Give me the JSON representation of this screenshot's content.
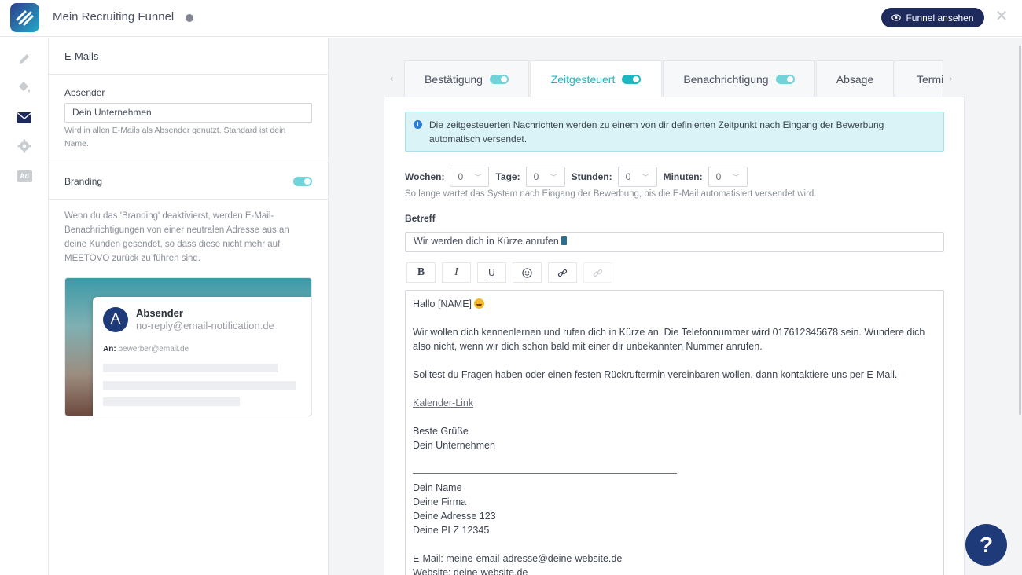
{
  "app": {
    "funnel_title": "Mein Recruiting Funnel",
    "view_button": "Funnel ansehen"
  },
  "rail": {
    "icons": [
      "pencil-icon",
      "paint-bucket-icon",
      "envelope-icon",
      "gear-icon",
      "ad-icon"
    ],
    "active": "envelope-icon",
    "ad_label": "Ad"
  },
  "panel": {
    "header": "E-Mails",
    "sender": {
      "label": "Absender",
      "value": "Dein Unternehmen",
      "hint": "Wird in allen E-Mails als Absender genutzt. Standard ist dein Name."
    },
    "branding": {
      "label": "Branding",
      "enabled": true,
      "description": "Wenn du das 'Branding' deaktivierst, werden E-Mail-Benachrichtigungen von einer neutralen Adresse aus an deine Kunden gesendet, so dass diese nicht mehr auf MEETOVO zurück zu führen sind."
    },
    "preview": {
      "avatar_letter": "A",
      "sender_name": "Absender",
      "sender_email": "no-reply@email-notification.de",
      "to_label": "An:",
      "to_email": "bewerber@email.de"
    }
  },
  "tabs": [
    {
      "label": "Bestätigung",
      "toggle": true,
      "active": false
    },
    {
      "label": "Zeitgesteuert",
      "toggle": true,
      "active": true
    },
    {
      "label": "Benachrichtigung",
      "toggle": true,
      "active": false
    },
    {
      "label": "Absage",
      "toggle": false,
      "active": false
    },
    {
      "label": "Termi",
      "toggle": false,
      "active": false
    }
  ],
  "content": {
    "info": "Die zeitgesteuerten Nachrichten werden zu einem von dir definierten Zeitpunkt nach Eingang der Bewerbung automatisch versendet.",
    "delay": {
      "weeks_label": "Wochen:",
      "weeks": "0",
      "days_label": "Tage:",
      "days": "0",
      "hours_label": "Stunden:",
      "hours": "0",
      "minutes_label": "Minuten:",
      "minutes": "0",
      "hint": "So lange wartet das System nach Eingang der Bewerbung, bis die E-Mail automatisiert versendet wird."
    },
    "subject_label": "Betreff",
    "subject_value": "Wir werden dich in Kürze anrufen",
    "toolbar": {
      "bold": "B",
      "italic": "I",
      "underline": "U"
    },
    "body": {
      "greeting": "Hallo [NAME]",
      "line1": "Wir wollen dich kennenlernen und rufen dich in Kürze an. Die Telefonnummer wird 017612345678 sein. Wundere dich also nicht, wenn wir dich schon bald mit einer dir unbekannten Nummer anrufen.",
      "line2": "Solltest du Fragen haben oder einen festen Rückruftermin vereinbaren wollen, dann kontaktiere uns per E-Mail.",
      "calendar_link": "Kalender-Link",
      "regards": "Beste Grüße",
      "company": "Dein Unternehmen",
      "sig_name": "Dein Name",
      "sig_firm": "Deine Firma",
      "sig_address": "Deine Adresse 123",
      "sig_zip": "Deine PLZ 12345",
      "sig_email": "E-Mail: meine-email-adresse@deine-website.de",
      "sig_web": "Website: deine-website.de"
    }
  },
  "help": {
    "label": "?"
  },
  "colors": {
    "accent": "#1cb8c2",
    "navy": "#1e2a5c",
    "info_bg": "#d9f3f7"
  }
}
